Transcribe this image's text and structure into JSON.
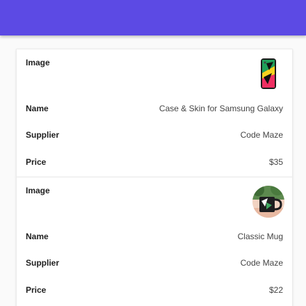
{
  "colors": {
    "app_bar": "#5c4ae4"
  },
  "products": [
    {
      "image_label": "Image",
      "image_icon": "phone-case-icon",
      "name_label": "Name",
      "name": "Case & Skin for Samsung Galaxy",
      "supplier_label": "Supplier",
      "supplier": "Code Maze",
      "price_label": "Price",
      "price": "$35"
    },
    {
      "image_label": "Image",
      "image_icon": "mug-photo-icon",
      "name_label": "Name",
      "name": "Classic Mug",
      "supplier_label": "Supplier",
      "supplier": "Code Maze",
      "price_label": "Price",
      "price": "$22"
    }
  ]
}
